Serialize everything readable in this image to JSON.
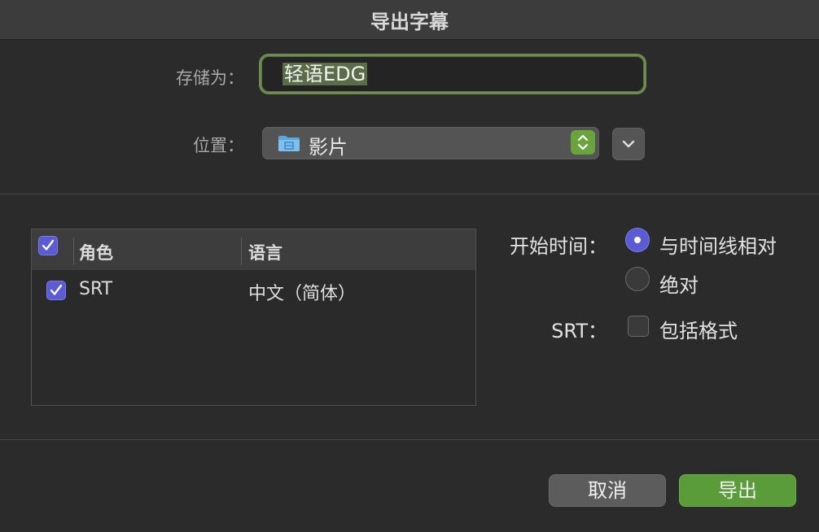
{
  "window": {
    "title": "导出字幕"
  },
  "save_as": {
    "label": "存储为：",
    "value": "轻语EDG"
  },
  "location": {
    "label": "位置：",
    "value": "影片",
    "icon": "folder-icon"
  },
  "roles_table": {
    "headers": {
      "role": "角色",
      "language": "语言"
    },
    "rows": [
      {
        "role": "SRT",
        "language": "中文（简体）",
        "checked": true
      }
    ]
  },
  "start_time": {
    "label": "开始时间：",
    "options": [
      {
        "label": "与时间线相对",
        "selected": true
      },
      {
        "label": "绝对",
        "selected": false
      }
    ]
  },
  "srt": {
    "label": "SRT：",
    "include_format_label": "包括格式",
    "checked": false
  },
  "buttons": {
    "cancel": "取消",
    "export": "导出"
  },
  "colors": {
    "accent": "#5b5bd6",
    "primary_button": "#5b9c3a",
    "focus_ring": "#6e8c4f"
  }
}
